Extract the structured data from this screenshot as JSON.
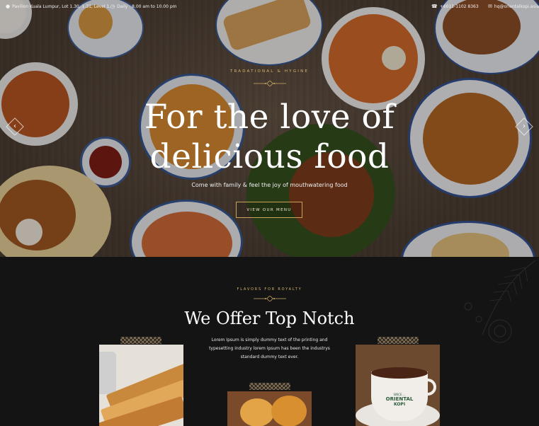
{
  "topbar": {
    "address": "Pavilion Kuala Lumpur, Lot 1.30, 1.31, Level 1,",
    "hours": "Daily : 8.00 am to 10.00 pm",
    "phone": "+6011-1102 8363",
    "email": "hq@orientalkopi.asia",
    "icons": {
      "location": "map-pin-icon",
      "clock": "clock-icon",
      "phone": "phone-icon",
      "email": "mail-icon"
    }
  },
  "hero": {
    "eyebrow": "TRADATIONAL & HYGINE",
    "title_line1": "For the love of",
    "title_line2": "delicious food",
    "subtitle": "Come with family & feel the joy of mouthwatering food",
    "button_label": "VIEW OUR MENU",
    "prev_arrow": "‹",
    "next_arrow": "›"
  },
  "offer": {
    "eyebrow": "FLAVORS FOR ROYALTY",
    "title": "We Offer Top Notch",
    "body": "Lorem Ipsum is simply dummy text of the printing and typesetting industry lorem Ipsum has been the industrys standard dummy text ever."
  },
  "cards": [
    {
      "name": "toast"
    },
    {
      "name": "egg-tart"
    },
    {
      "name": "coffee-cup"
    }
  ],
  "cup_label": {
    "line1": "SINCE ...",
    "line2": "ORIENTAL",
    "line3": "KOPI"
  },
  "colors": {
    "accent_gold": "#d9b46c",
    "section_bg": "#141414",
    "button_border": "#c9a35c"
  }
}
